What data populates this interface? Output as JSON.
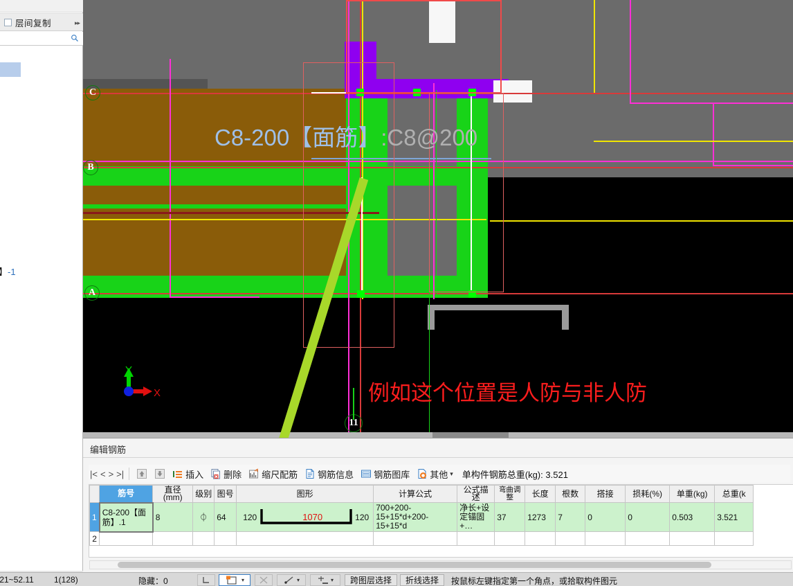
{
  "sidebar": {
    "menu_item": {
      "label": "层间复制",
      "arrow": "▸▸",
      "icon": "copy-between-floors-icon"
    },
    "search": {
      "placeholder": "",
      "value": "",
      "icon": "search-icon"
    },
    "tree_fragment": {
      "bracket": "】",
      "value": "-1"
    }
  },
  "canvas": {
    "member_label": "C8-200【面筋】",
    "member_spec": ":C8@200",
    "annotation": "例如这个位置是人防与非人防",
    "axis_bubbles": [
      "C",
      "B",
      "A"
    ],
    "grid_marker": "11",
    "ucs": {
      "x_label": "X",
      "y_label": "Y"
    }
  },
  "edit_panel": {
    "title": "编辑钢筋",
    "toolbar": {
      "nav_first": "|<",
      "nav_prev": "<",
      "nav_next": ">",
      "nav_last": ">|",
      "move_up_icon": "arrow-up-icon",
      "move_down_icon": "arrow-down-icon",
      "insert": "插入",
      "delete": "删除",
      "scale_rebar": "缩尺配筋",
      "rebar_info": "钢筋信息",
      "rebar_library": "钢筋图库",
      "other": "其他",
      "other_caret": "▾",
      "total_label": "单构件钢筋总重(kg):",
      "total_value": "3.521"
    },
    "columns": [
      "筋号",
      "直径(mm)",
      "级别",
      "图号",
      "图形",
      "计算公式",
      "公式描述",
      "弯曲调整",
      "长度",
      "根数",
      "搭接",
      "损耗(%)",
      "单重(kg)",
      "总重(k"
    ],
    "rows": [
      {
        "index": "1",
        "name": "C8-200【面筋】.1",
        "diameter": "8",
        "grade": "⏀",
        "drawing_no": "64",
        "shape": {
          "left": "120",
          "center": "1070",
          "right": "120"
        },
        "formula": "700+200-15+15*d+200-15+15*d",
        "formula_desc": "净长+设定锚固+…",
        "bend_adjust": "37",
        "length": "1273",
        "count": "7",
        "lap": "0",
        "loss": "0",
        "unit_weight": "0.503",
        "total_weight": "3.521"
      },
      {
        "index": "2",
        "name": "",
        "diameter": "",
        "grade": "",
        "drawing_no": "",
        "shape": {
          "left": "",
          "center": "",
          "right": ""
        },
        "formula": "",
        "formula_desc": "",
        "bend_adjust": "",
        "length": "",
        "count": "",
        "lap": "",
        "loss": "",
        "unit_weight": "",
        "total_weight": ""
      }
    ]
  },
  "status_bar": {
    "coords": ".21~52.11",
    "count": "1(128)",
    "hidden_label": "隐藏：0",
    "buttons": [
      {
        "name": "ortho-snap-button",
        "label": ""
      },
      {
        "name": "selection-mode-button",
        "label": ""
      },
      {
        "name": "intersection-snap-button",
        "label": ""
      },
      {
        "name": "line-snap-button",
        "label": ""
      },
      {
        "name": "point-snap-button",
        "label": ""
      },
      {
        "name": "cross-layer-select-button",
        "label": "跨图层选择"
      },
      {
        "name": "polyline-select-button",
        "label": "折线选择"
      }
    ],
    "message": "按鼠标左键指定第一个角点，或拾取构件图元"
  },
  "colors": {
    "accent": "#4fa3e3",
    "row_green": "#ccf2cc",
    "note_red": "#fb1d1d",
    "arrow_green": "#a8d82a",
    "label_blue": "#9fc0e8"
  }
}
